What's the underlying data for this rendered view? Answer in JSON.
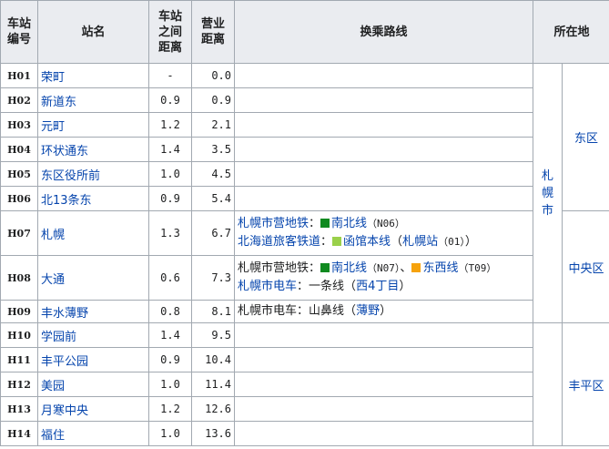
{
  "header": {
    "code": [
      "车站",
      "编号"
    ],
    "name": "站名",
    "between": [
      "车站",
      "之间",
      "距离"
    ],
    "total": [
      "营业",
      "距离"
    ],
    "transfer": "换乘路线",
    "location": "所在地"
  },
  "stations": [
    {
      "code": "H01",
      "name": "荣町",
      "between": "-",
      "total": "0.0"
    },
    {
      "code": "H02",
      "name": "新道东",
      "between": "0.9",
      "total": "0.9"
    },
    {
      "code": "H03",
      "name": "元町",
      "between": "1.2",
      "total": "2.1"
    },
    {
      "code": "H04",
      "name": "环状通东",
      "between": "1.4",
      "total": "3.5"
    },
    {
      "code": "H05",
      "name": "东区役所前",
      "between": "1.0",
      "total": "4.5"
    },
    {
      "code": "H06",
      "name": "北13条东",
      "between": "0.9",
      "total": "5.4"
    },
    {
      "code": "H07",
      "name": "札幌",
      "between": "1.3",
      "total": "6.7"
    },
    {
      "code": "H08",
      "name": "大通",
      "between": "0.6",
      "total": "7.3"
    },
    {
      "code": "H09",
      "name": "丰水薄野",
      "between": "0.8",
      "total": "8.1"
    },
    {
      "code": "H10",
      "name": "学园前",
      "between": "1.4",
      "total": "9.5"
    },
    {
      "code": "H11",
      "name": "丰平公园",
      "between": "0.9",
      "total": "10.4"
    },
    {
      "code": "H12",
      "name": "美园",
      "between": "1.0",
      "total": "11.4"
    },
    {
      "code": "H13",
      "name": "月寒中央",
      "between": "1.2",
      "total": "12.6"
    },
    {
      "code": "H14",
      "name": "福住",
      "between": "1.0",
      "total": "13.6"
    }
  ],
  "transfers": {
    "h07": {
      "l1_op": "札幌市营地铁",
      "l1_line": "南北线",
      "l1_code": "（N06）",
      "l2_op": "北海道旅客铁道",
      "l2_line": "函馆本线",
      "l2_open": "（",
      "l2_station": "札幌站",
      "l2_code": "（01）",
      "l2_close": "）"
    },
    "h08": {
      "l1_op": "札幌市营地铁",
      "l1_line_a": "南北线",
      "l1_code_a": "（N07）",
      "sep": "、",
      "l1_line_b": "东西线",
      "l1_code_b": "（T09）",
      "l2_op": "札幌市电车",
      "l2_line": "一条线",
      "l2_open": "（",
      "l2_station": "西4丁目",
      "l2_close": "）"
    },
    "h09": {
      "op": "札幌市电车",
      "line": "山鼻线",
      "open": "（",
      "station": "薄野",
      "close": "）"
    },
    "colon": "："
  },
  "location": {
    "city": [
      "札",
      "幌",
      "市"
    ],
    "wards": [
      "东区",
      "中央区",
      "丰平区"
    ]
  },
  "colors": {
    "nanboku": "#108a20",
    "tozai": "#f6a20c",
    "hakodate": "#9ad04a",
    "link": "#0645ad",
    "header_bg": "#eaecf0",
    "border": "#a2a9b1"
  }
}
